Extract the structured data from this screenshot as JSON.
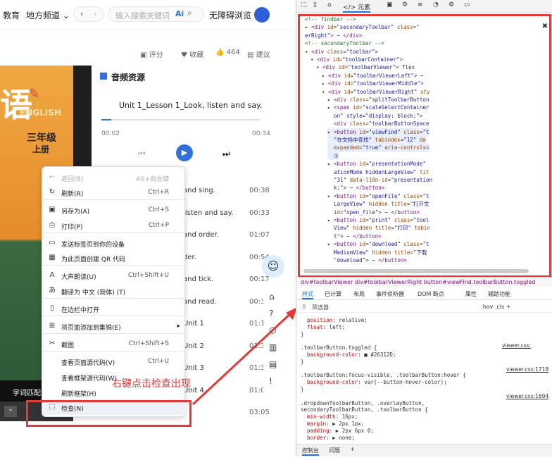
{
  "browser": {
    "nav_left": "教育",
    "channel": "地方频道",
    "search_placeholder": "输入搜索关键词",
    "ai_label": "Ai",
    "barrier": "无障碍浏览"
  },
  "actions": {
    "rate": "评分",
    "collect": "收藏",
    "likes": "464",
    "suggest": "建议"
  },
  "lesson": {
    "title_char": "语",
    "english": "ENGLISH",
    "grade": "三年级",
    "volume": "上册",
    "tab": "字词匹配"
  },
  "audio": {
    "header": "音频资源",
    "track": "Unit 1_Lesson 1_Look, listen and say.",
    "time_now": "00:02",
    "time_total": "00:34",
    "items": [
      {
        "t": "and sing.",
        "d": "00:38"
      },
      {
        "t": "listen and say.",
        "d": "00:33"
      },
      {
        "t": "and order.",
        "d": "01:07"
      },
      {
        "t": "der.",
        "d": "00:54"
      },
      {
        "t": "and tick.",
        "d": "00:17"
      },
      {
        "t": "and read.",
        "d": "00:33"
      },
      {
        "t": "Unit 1",
        "d": "01:14"
      },
      {
        "t": "Unit 2",
        "d": "01:3"
      },
      {
        "t": "Unit 3",
        "d": "01:3"
      },
      {
        "t": "Unit 4",
        "d": "01:0"
      },
      {
        "t": "",
        "d": "03:05"
      }
    ]
  },
  "menu": [
    {
      "label": "返回(B)",
      "sc": "Alt+向左键",
      "icon": "←",
      "gray": true
    },
    {
      "label": "刷新(R)",
      "sc": "Ctrl+R",
      "icon": "↻"
    },
    {
      "label": "另存为(A)",
      "sc": "Ctrl+S",
      "icon": "▣"
    },
    {
      "label": "打印(P)",
      "sc": "Ctrl+P",
      "icon": "⎙"
    },
    {
      "label": "发送标签页到你的设备",
      "sc": "",
      "icon": "▭"
    },
    {
      "label": "为此页面创建 QR 代码",
      "sc": "",
      "icon": "▦"
    },
    {
      "label": "大声朗读(U)",
      "sc": "Ctrl+Shift+U",
      "icon": "A"
    },
    {
      "label": "翻译为 中文 (简体) (T)",
      "sc": "",
      "icon": "あ"
    },
    {
      "label": "在边栏中打开",
      "sc": "",
      "icon": "▯"
    },
    {
      "label": "将页面添加到集锦(E)",
      "sc": "",
      "icon": "⊞",
      "arrow": "▸"
    },
    {
      "label": "截图",
      "sc": "Ctrl+Shift+S",
      "icon": "✂"
    },
    {
      "label": "查看页面源代码(V)",
      "sc": "Ctrl+U",
      "icon": ""
    },
    {
      "label": "查看框架源代码(W)",
      "sc": "",
      "icon": ""
    },
    {
      "label": "刷新框架(H)",
      "sc": "",
      "icon": ""
    },
    {
      "label": "检查(N)",
      "sc": "",
      "icon": "⬚"
    }
  ],
  "annotation": "右键点击检查出现",
  "devtools": {
    "tabs": [
      "元素"
    ],
    "code": [
      {
        "i": 1,
        "h": "<span class='cm'>&lt;!-- findbar --&gt;</span>"
      },
      {
        "i": 1,
        "h": "▸ <span class='tag'>&lt;div</span> <span class='attr'>id</span>=<span class='val'>\"secondaryToolbar\"</span> <span class='attr'>class</span>=<span class='val'>\"</span>"
      },
      {
        "i": 1,
        "h": "<span class='val'>erRight\"</span><span class='tag'>&gt;</span> ⋯ <span class='tag'>&lt;/div&gt;</span>"
      },
      {
        "i": 1,
        "h": "<span class='cm'>&lt;!-- secondaryToolbar --&gt;</span>"
      },
      {
        "i": 1,
        "h": "▾ <span class='tag'>&lt;div</span> <span class='attr'>class</span>=<span class='val'>\"toolbar\"</span><span class='tag'>&gt;</span>"
      },
      {
        "i": 2,
        "h": "▾ <span class='tag'>&lt;div</span> <span class='attr'>id</span>=<span class='val'>\"toolbarContainer\"</span><span class='tag'>&gt;</span>"
      },
      {
        "i": 3,
        "h": "▾ <span class='tag'>&lt;div</span> <span class='attr'>id</span>=<span class='val'>\"toolbarViewer\"</span><span class='tag'>&gt;</span> flex"
      },
      {
        "i": 4,
        "h": "▸ <span class='tag'>&lt;div</span> <span class='attr'>id</span>=<span class='val'>\"toolbarViewerLeft\"</span><span class='tag'>&gt;</span> ⋯"
      },
      {
        "i": 4,
        "h": "▸ <span class='tag'>&lt;div</span> <span class='attr'>id</span>=<span class='val'>\"toolbarViewerMiddle\"</span><span class='tag'>&gt;</span>"
      },
      {
        "i": 4,
        "h": "▾ <span class='tag'>&lt;div</span> <span class='attr'>id</span>=<span class='val'>\"toolbarViewerRight\"</span> <span class='attr'>sty</span>"
      },
      {
        "i": 5,
        "h": "▸ <span class='tag'>&lt;div</span> <span class='attr'>class</span>=<span class='val'>\"splitToolbarButton</span>"
      },
      {
        "i": 5,
        "h": "▸ <span class='tag'>&lt;span</span> <span class='attr'>id</span>=<span class='val'>\"scaleSelectContainer</span>"
      },
      {
        "i": 5,
        "h": "  <span class='val'>on\" style=\"display: block;\"</span>&gt;"
      },
      {
        "i": 5,
        "h": "  <span class='tag'>&lt;div</span> <span class='attr'>class</span>=<span class='val'>\"toolbarButtonSpace</span>"
      },
      {
        "i": 5,
        "h": "▸ <span class='tag'>&lt;button</span> <span class='attr'>id</span>=<span class='val'>\"viewFind\"</span> <span class='attr'>class</span>=<span class='val'>\"t</span>"
      },
      {
        "i": 5,
        "h": "  <span class='val'>\"在文档中查找\"</span> <span class='attr'>tabindex</span>=<span class='val'>\"12\"</span> <span class='attr'>da</span>"
      },
      {
        "i": 5,
        "h": "  <span class='attr'>expanded</span>=<span class='val'>\"true\"</span> <span class='attr'>aria-controls</span>="
      },
      {
        "i": 5,
        "h": "  <span class='val'>⑦</span>"
      },
      {
        "i": 5,
        "h": "▸ <span class='tag'>&lt;button</span> <span class='attr'>id</span>=<span class='val'>\"presentationMode\"</span>"
      },
      {
        "i": 5,
        "h": "  <span class='val'>ationMode hiddenLargeView\"</span> <span class='attr'>tit</span>"
      },
      {
        "i": 5,
        "h": "  <span class='val'>\"31\"</span> <span class='attr'>data-l10n-id</span>=<span class='val'>\"presentation</span>"
      },
      {
        "i": 5,
        "h": "  <span class='val'>k;\"</span>&gt; ⋯ <span class='tag'>&lt;/button&gt;</span>"
      },
      {
        "i": 5,
        "h": "▸ <span class='tag'>&lt;button</span> <span class='attr'>id</span>=<span class='val'>\"openFile\"</span> <span class='attr'>class</span>=<span class='val'>\"t</span>"
      },
      {
        "i": 5,
        "h": "  <span class='val'>LargeView\"</span> <span class='attr'>hidden</span> <span class='attr'>title</span>=<span class='val'>\"打开文</span>"
      },
      {
        "i": 5,
        "h": "  <span class='attr'>id</span>=<span class='val'>\"open_file\"</span>&gt; ⋯ <span class='tag'>&lt;/button&gt;</span>"
      },
      {
        "i": 5,
        "h": "▸ <span class='tag'>&lt;button</span> <span class='attr'>id</span>=<span class='val'>\"print\"</span> <span class='attr'>class</span>=<span class='val'>\"tool</span>"
      },
      {
        "i": 5,
        "h": "  <span class='val'>View\"</span> <span class='attr'>hidden</span> <span class='attr'>title</span>=<span class='val'>\"打印\"</span> <span class='attr'>tabin</span>"
      },
      {
        "i": 5,
        "h": "  <span class='val'>t\"</span>&gt; ⋯ <span class='tag'>&lt;/button&gt;</span>"
      },
      {
        "i": 5,
        "h": "▸ <span class='tag'>&lt;button</span> <span class='attr'>id</span>=<span class='val'>\"download\"</span> <span class='attr'>class</span>=<span class='val'>\"t</span>"
      },
      {
        "i": 5,
        "h": "  <span class='val'>MediumView\"</span> <span class='attr'>hidden</span> <span class='attr'>title</span>=<span class='val'>\"下载</span>"
      },
      {
        "i": 5,
        "h": "  <span class='val'>\"download\"</span>&gt; ⋯ <span class='tag'>&lt;/button&gt;</span>"
      },
      {
        "i": 5,
        "h": "  ⋯"
      }
    ],
    "crumbs": "div#toolbarViewer   div#toolbarViewerRight   button#viewFind.toolbarButton.toggled",
    "style_tabs": [
      "样式",
      "已计算",
      "布局",
      "事件侦听器",
      "DOM 断点",
      "属性",
      "辅助功能"
    ],
    "filter": "筛选器",
    "filter_flags": ":hov .cls +",
    "css": [
      {
        "h": "  <span class='prop'>position</span>: relative;"
      },
      {
        "h": "  <span class='prop'>float</span>: left;"
      },
      {
        "h": "}"
      },
      {
        "h": ""
      },
      {
        "h": ".toolbarButton.toggled {"
      },
      {
        "h": "  <span class='prop'>background-color</span>: ■ #26312D;"
      },
      {
        "h": "}"
      },
      {
        "h": ""
      },
      {
        "h": ".toolbarButton:focus-visible, .toolbarButton:hover {"
      },
      {
        "h": "  <span class='prop'>background-color</span>: var(--button-hover-color);"
      },
      {
        "h": "}"
      },
      {
        "h": ""
      },
      {
        "h": ".dropdownToolbarButton, .overlayButton,"
      },
      {
        "h": "secondaryToolbarButton, .toolbarButton {"
      },
      {
        "h": "  <span class='prop'>min-width</span>: 16px;"
      },
      {
        "h": "  <span class='prop'>margin</span>: ▶ 2px 1px;"
      },
      {
        "h": "  <span class='prop'>padding</span>: ▶ 2px 6px 0;"
      },
      {
        "h": "  <span class='prop'>border</span>: ▶ none;"
      }
    ],
    "css_files": [
      "viewer.css:",
      "viewer.css:1718",
      "viewer.css:1694"
    ],
    "bottom": [
      "控制台",
      "问题"
    ]
  },
  "colors": {
    "accent": "#2f6fde",
    "red": "#e53935",
    "brand": "#1e1e1e"
  }
}
